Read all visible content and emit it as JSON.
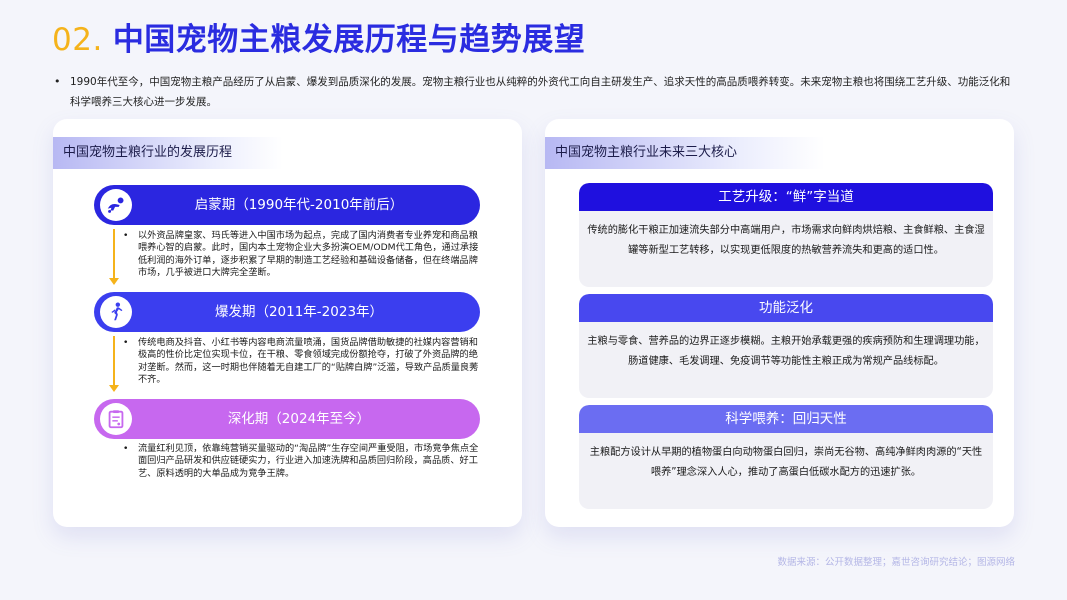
{
  "header": {
    "number": "02.",
    "title": "中国宠物主粮发展历程与趋势展望"
  },
  "intro": "1990年代至今，中国宠物主粮产品经历了从启蒙、爆发到品质深化的发展。宠物主粮行业也从纯粹的外资代工向自主研发生产、追求天性的高品质喂养转变。未来宠物主粮也将围绕工艺升级、功能泛化和科学喂养三大核心进一步发展。",
  "left": {
    "header": "中国宠物主粮行业的发展历程",
    "phases": [
      {
        "title": "启蒙期（1990年代-2010年前后）",
        "text": "以外资品牌皇家、玛氏等进入中国市场为起点，完成了国内消费者专业养宠和商品粮喂养心智的启蒙。此时，国内本土宠物企业大多扮演OEM/ODM代工角色，通过承接低利润的海外订单，逐步积累了早期的制造工艺经验和基础设备储备，但在终端品牌市场，几乎被进口大牌完全垄断。",
        "color": "#2b26e0",
        "icon": "baby-crawling-icon"
      },
      {
        "title": "爆发期（2011年-2023年）",
        "text": "传统电商及抖音、小红书等内容电商流量喷涌，国货品牌借助敏捷的社媒内容营销和极高的性价比定位实现卡位，在干粮、零食领域完成份额抢夺，打破了外资品牌的绝对垄断。然而，这一时期也伴随着无自建工厂的“贴牌白牌”泛滥，导致产品质量良莠不齐。",
        "color": "#3b3eef",
        "icon": "athlete-icon"
      },
      {
        "title": "深化期（2024年至今）",
        "text": "流量红利见顶，依靠纯营销买量驱动的“淘品牌”生存空间严重受阻，市场竞争焦点全面回归产品研发和供应链硬实力，行业进入加速洗牌和品质回归阶段，高品质、好工艺、原料透明的大单品成为竞争王牌。",
        "color": "#c768ef",
        "icon": "clipboard-icon"
      }
    ]
  },
  "right": {
    "header": "中国宠物主粮行业未来三大核心",
    "cores": [
      {
        "title": "工艺升级：“鲜”字当道",
        "text": "传统的膨化干粮正加速流失部分中高端用户，市场需求向鲜肉烘焙粮、主食鲜粮、主食湿罐等新型工艺转移，以实现更低限度的热敏营养流失和更高的适口性。",
        "color": "#1f10df"
      },
      {
        "title": "功能泛化",
        "text": "主粮与零食、营养品的边界正逐步模糊。主粮开始承载更强的疾病预防和生理调理功能，肠道健康、毛发调理、免疫调节等功能性主粮正成为常规产品线标配。",
        "color": "#4848ef"
      },
      {
        "title": "科学喂养：回归天性",
        "text": "主粮配方设计从早期的植物蛋白向动物蛋白回归，崇尚无谷物、高纯净鲜肉肉源的“天性喂养”理念深入人心，推动了高蛋白低碳水配方的迅速扩张。",
        "color": "#6b6df2"
      }
    ]
  },
  "source": "数据来源：公开数据整理；嘉世咨询研究结论；图源网络"
}
